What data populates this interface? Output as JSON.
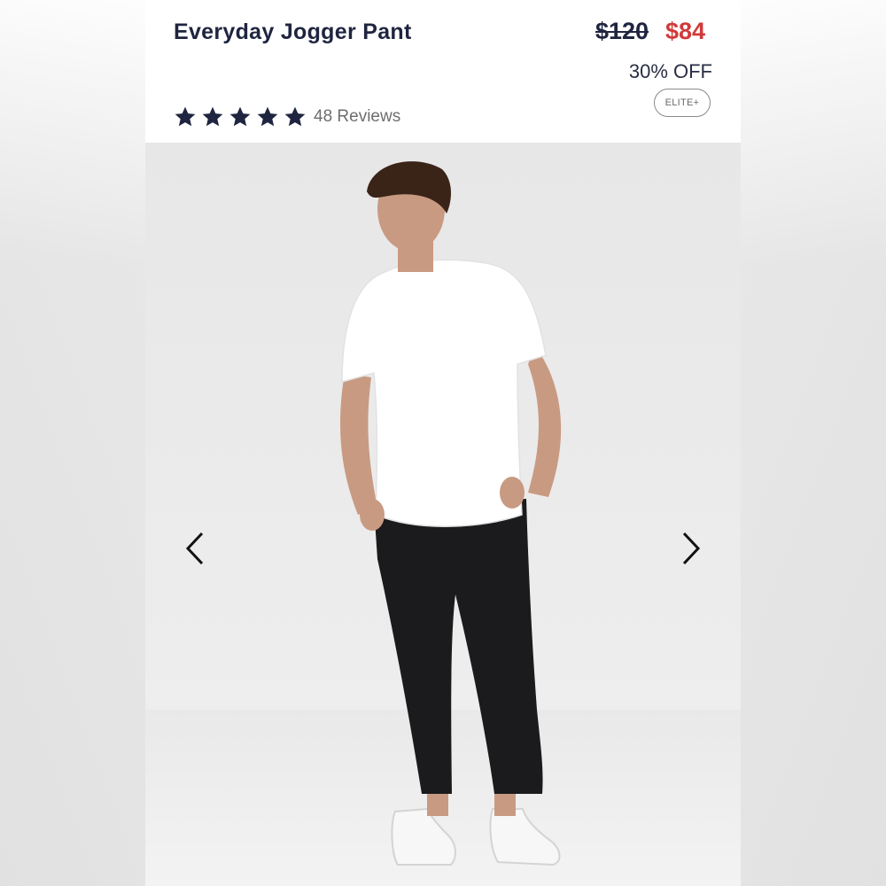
{
  "product": {
    "title": "Everyday Jogger Pant",
    "price_original": "$120",
    "price_sale": "$84",
    "discount_label": "30% OFF",
    "badge": "ELITE+",
    "rating_stars": 5,
    "reviews_label": "48 Reviews"
  },
  "colors": {
    "title": "#1f2540",
    "sale_price": "#d13a3a",
    "star": "#1f2540"
  },
  "icons": {
    "star": "star-icon",
    "prev": "chevron-left-icon",
    "next": "chevron-right-icon"
  },
  "image": {
    "alt": "Model wearing white t-shirt and black jogger pants with white sneakers"
  }
}
